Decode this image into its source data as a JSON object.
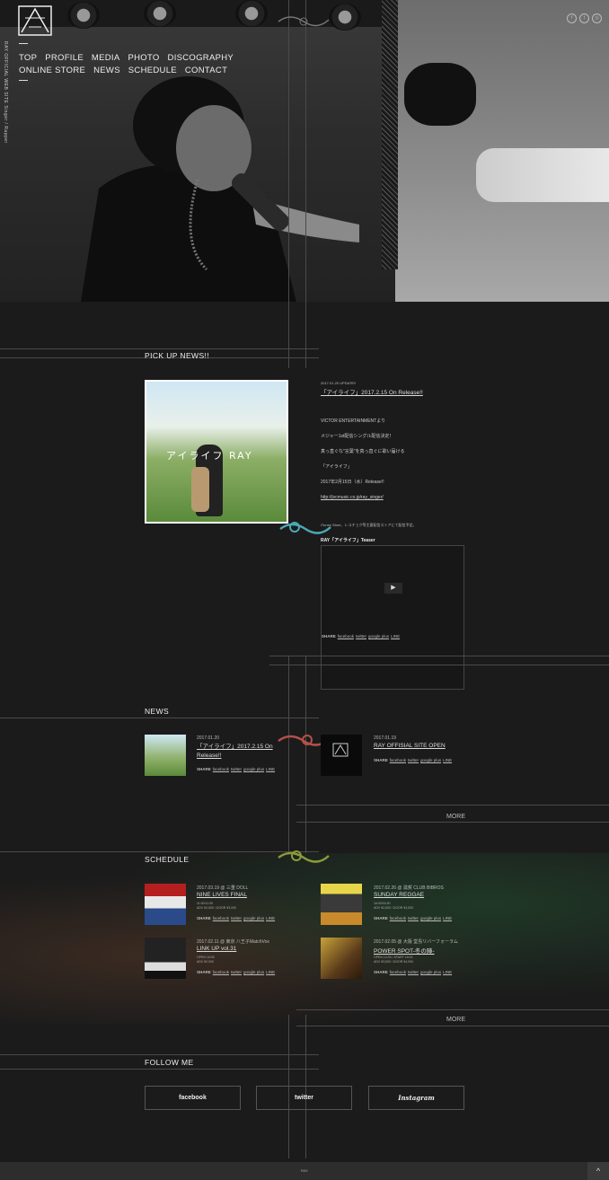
{
  "brand": {
    "logo_alt": "RAY",
    "side_text": "RAY OFFICIAL WEB SITE Singer / Rapper",
    "social_top": [
      "facebook-icon",
      "twitter-icon",
      "instagram-icon"
    ]
  },
  "nav": {
    "items": [
      "TOP",
      "PROFILE",
      "MEDIA",
      "PHOTO",
      "DISCOGRAPHY",
      "ONLINE STORE",
      "NEWS",
      "SCHEDULE",
      "CONTACT"
    ]
  },
  "pickup": {
    "title": "PICK UP NEWS!!",
    "date": "2017.01.20 UPDATE!!",
    "headline": "「アイライフ」2017.2.15 On Release!!",
    "image_text": "アイライフ RAY",
    "body": [
      "VICTOR ENTERTAINMENTより",
      "メジャー1st配信シングル配信決定！",
      "真っ直ぐな\"言葉\"を真っ直ぐに歌い届ける",
      "「アイライフ」",
      "2017年2月15日（水）Release!!",
      "http://jvcmusic.co.jp/ray_singer/"
    ],
    "itunes_note": "iTunes Store、レコチョク等主要配信ストアにて配信予定。",
    "video_title": "RAY「アイライフ」Teaser",
    "share_label": "SHARE",
    "share_links": [
      "facebook",
      "twitter",
      "google plus",
      "LINE"
    ]
  },
  "news": {
    "title": "NEWS",
    "more": "MORE",
    "items": [
      {
        "date": "2017.01.20",
        "title": "「アイライフ」2017.2.15 On Release!!",
        "share": "SHARE",
        "links": [
          "facebook",
          "twitter",
          "google plus",
          "LINE"
        ]
      },
      {
        "date": "2017.01.19",
        "title": "RAY OFFISIAL SITE OPEN",
        "share": "SHARE",
        "links": [
          "facebook",
          "twitter",
          "google plus",
          "LINE"
        ]
      }
    ]
  },
  "schedule": {
    "title": "SCHEDULE",
    "more": "MORE",
    "items": [
      {
        "date": "2017.03.19 @ 三重 DOLL",
        "title": "NINE LIVES FINAL",
        "info": [
          "11:00/11:30",
          "ADV ¥2,500 / DOOR ¥3,000"
        ],
        "share": "SHARE",
        "links": [
          "facebook",
          "twitter",
          "google plus",
          "LINE"
        ]
      },
      {
        "date": "2017.02.26 @ 滋賀 CLUB BIBROS",
        "title": "SUNDAY REGGAE",
        "info": [
          "16:00/16:30",
          "ADV ¥2,500 / DOOR ¥3,000"
        ],
        "share": "SHARE",
        "links": [
          "facebook",
          "twitter",
          "google plus",
          "LINE"
        ]
      },
      {
        "date": "2017.02.11 @ 東京 八王子MatchVox",
        "title": "LINK UP vol.31",
        "info": [
          "OPEN 16:00",
          "ADV ¥2,000"
        ],
        "share": "SHARE",
        "links": [
          "facebook",
          "twitter",
          "google plus",
          "LINE"
        ]
      },
      {
        "date": "2017.02.05 @ 大阪 堂島リバーフォーラム",
        "title": "POWER SPOT-冬の陣-",
        "info": [
          "OPEN 13:30 / START 14:00",
          "ADV ¥3,500 / DOOR ¥4,000"
        ],
        "share": "SHARE",
        "links": [
          "facebook",
          "twitter",
          "google plus",
          "LINE"
        ]
      }
    ]
  },
  "follow": {
    "title": "FOLLOW ME",
    "buttons": [
      "facebook",
      "twitter",
      "Instagram"
    ]
  },
  "footer": {
    "copyright": "RAY",
    "to_top": "^"
  },
  "colors": {
    "bg": "#1b1b1b",
    "ornament_cyan": "#4aa8b4",
    "ornament_red": "#b4504a",
    "ornament_olive": "#8c9a3a"
  }
}
